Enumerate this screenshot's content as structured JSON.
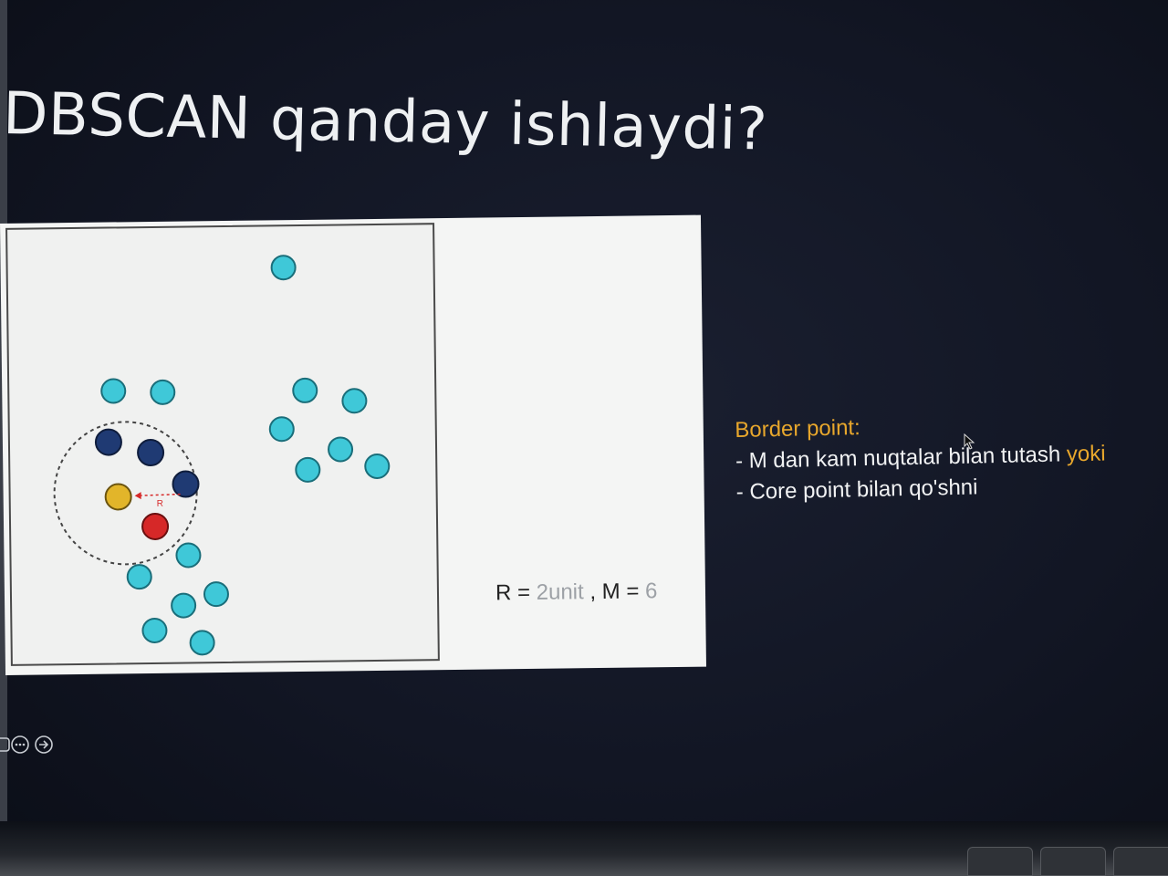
{
  "slide": {
    "title": "DBSCAN qanday ishlaydi?"
  },
  "figure": {
    "radius_label": "R",
    "params": {
      "r_prefix": "R = ",
      "r_value": "2unit",
      "m_prefix": " , M = ",
      "m_value": "6"
    }
  },
  "explanation": {
    "heading": "Border point:",
    "line1_text": "- M dan kam nuqtalar bilan tutash",
    "line1_highlight": "yoki",
    "line2": "- Core point  bilan qo'shni"
  },
  "controls": {
    "items": [
      "menu-icon",
      "more-icon",
      "next-slide-icon"
    ]
  },
  "colors": {
    "background": "#121624",
    "title": "#eef0f2",
    "cyan_point": "#3fc8d8",
    "navy_point": "#1f3a73",
    "yellow_point": "#e2b52a",
    "red_point": "#d62828",
    "accent_orange": "#e8a72c"
  }
}
